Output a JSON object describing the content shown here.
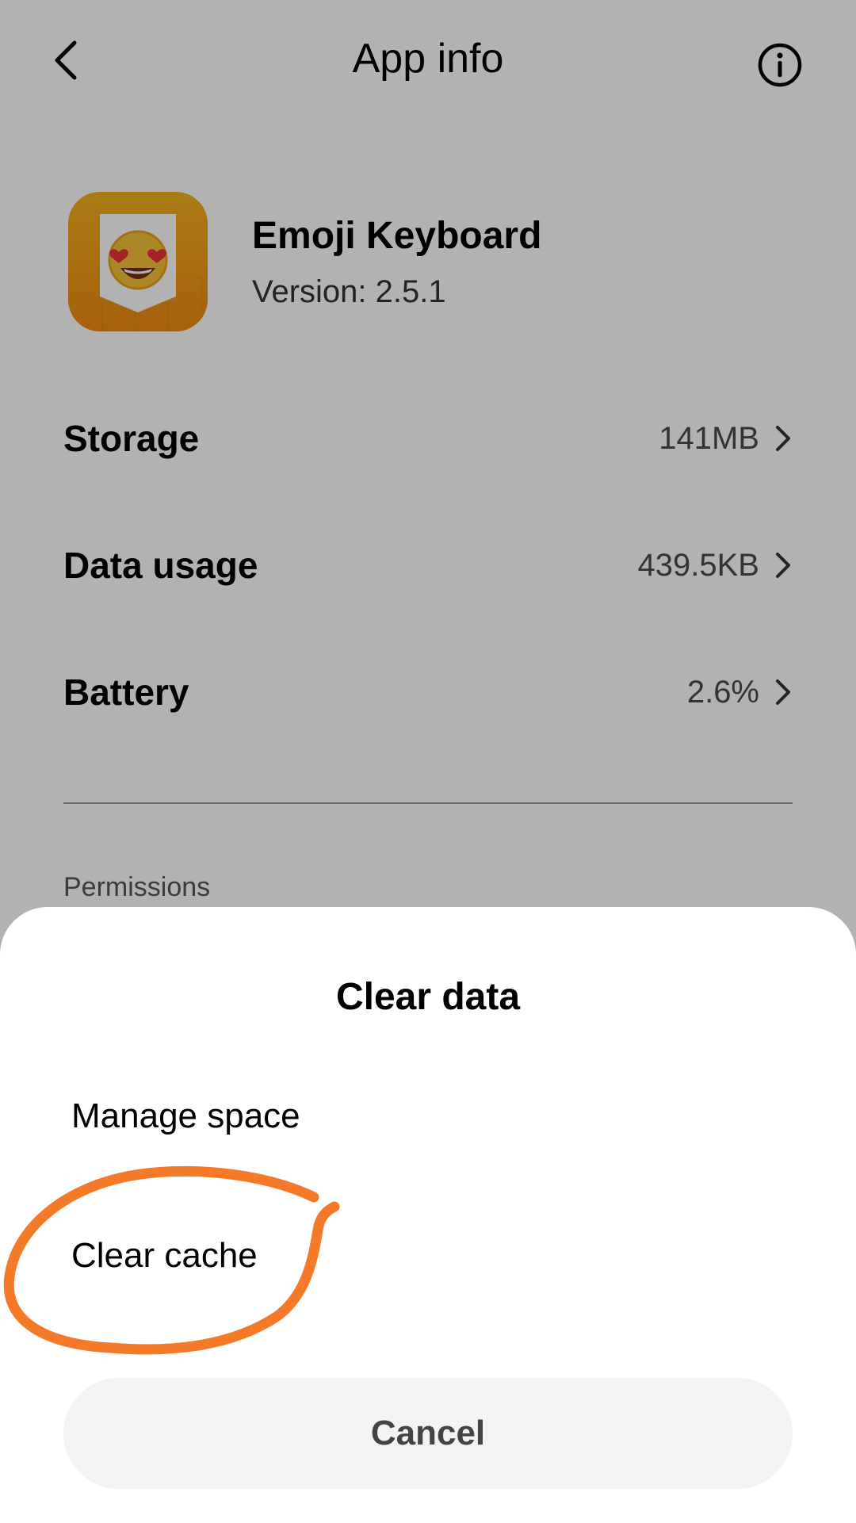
{
  "header": {
    "title": "App info",
    "back_icon": "chevron-left-icon",
    "info_icon": "info-circle-icon"
  },
  "app": {
    "name": "Emoji Keyboard",
    "version": "Version: 2.5.1",
    "icon": "emoji-keyboard-app-icon"
  },
  "rows": [
    {
      "label": "Storage",
      "value": "141MB"
    },
    {
      "label": "Data usage",
      "value": "439.5KB"
    },
    {
      "label": "Battery",
      "value": "2.6%"
    }
  ],
  "permissions_label": "Permissions",
  "sheet": {
    "title": "Clear data",
    "options": [
      "Manage space",
      "Clear cache"
    ],
    "cancel_label": "Cancel"
  },
  "colors": {
    "annotation": "#f47a2a",
    "app_icon_orange": "#f29a16"
  }
}
